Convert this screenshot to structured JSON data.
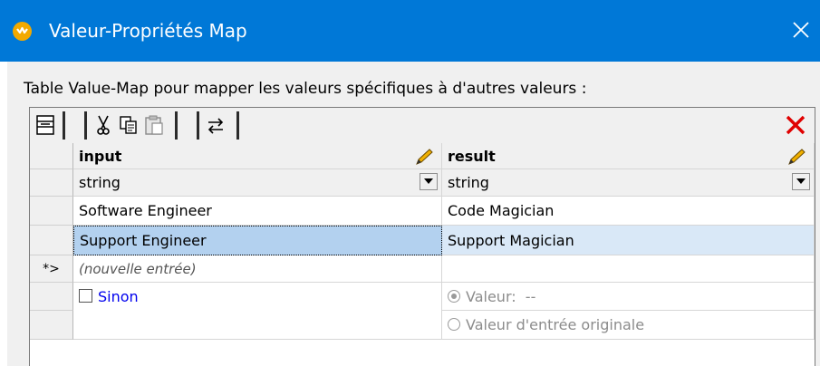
{
  "window": {
    "title": "Valeur-Propriétés Map",
    "description": "Table  Value-Map pour mapper les valeurs spécifiques à d'autres valeurs :"
  },
  "toolbar": {
    "buttons": [
      "insert-row-icon",
      "cut-icon",
      "copy-icon",
      "paste-icon",
      "swap-columns-icon",
      "delete-row-icon"
    ]
  },
  "table": {
    "columns": [
      {
        "header": "input",
        "type": "string"
      },
      {
        "header": "result",
        "type": "string"
      }
    ],
    "rows": [
      {
        "input": "Software Engineer",
        "result": "Code Magician",
        "selected": false
      },
      {
        "input": "Support Engineer",
        "result": "Support Magician",
        "selected": true
      }
    ],
    "new_entry_marker": "*>",
    "new_entry_placeholder": "(nouvelle entrée)",
    "otherwise": {
      "label": "Sinon",
      "checked": false,
      "option_value_label": "Valeur:",
      "option_value": "--",
      "option_original_label": "Valeur d'entrée originale"
    }
  },
  "colors": {
    "titlebar": "#0078d7",
    "selection": "#b3d1ef",
    "delete_icon": "#e00000",
    "link": "#0000ee"
  }
}
